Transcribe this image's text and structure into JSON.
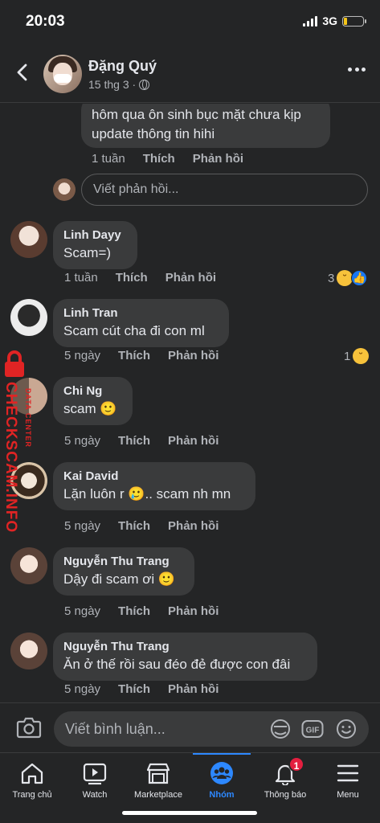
{
  "status": {
    "time": "20:03",
    "network": "3G"
  },
  "header": {
    "name": "Đặng Quý",
    "date": "15 thg 3 ·"
  },
  "top_reply": {
    "text_line1": "hôm qua ôn sinh bục mặt chưa kịp",
    "text_line2": "update thông tin hihi",
    "time": "1 tuần",
    "like": "Thích",
    "reply": "Phản hồi",
    "reply_placeholder": "Viết phản hồi..."
  },
  "comments": [
    {
      "name": "Linh Dayy",
      "text": "Scam=)",
      "time": "1 tuần",
      "like": "Thích",
      "reply": "Phản hồi",
      "reaction_count": "3"
    },
    {
      "name": "Linh Tran",
      "text": "Scam cút cha đi con ml",
      "time": "5 ngày",
      "like": "Thích",
      "reply": "Phản hồi",
      "reaction_count": "1"
    },
    {
      "name": "Chi Ng",
      "text": "scam 🙂",
      "time": "5 ngày",
      "like": "Thích",
      "reply": "Phản hồi"
    },
    {
      "name": "Kai David",
      "text": "Lặn luôn r 🥲.. scam nh mn",
      "time": "5 ngày",
      "like": "Thích",
      "reply": "Phản hồi"
    },
    {
      "name": "Nguyễn Thu Trang",
      "text": "Dậy đi scam ơi 🙂",
      "time": "5 ngày",
      "like": "Thích",
      "reply": "Phản hồi"
    },
    {
      "name": "Nguyễn Thu Trang",
      "text": "Ăn ở thế rồi sau đéo đẻ được con đâi",
      "time": "5 ngày",
      "like": "Thích",
      "reply": "Phản hồi"
    }
  ],
  "watermark": {
    "main": "CHECKSCAM.INFO",
    "sub": "DATA CENTER"
  },
  "composer": {
    "placeholder": "Viết bình luận..."
  },
  "tabs": [
    {
      "label": "Trang chủ",
      "icon": "home-icon"
    },
    {
      "label": "Watch",
      "icon": "watch-icon"
    },
    {
      "label": "Marketplace",
      "icon": "marketplace-icon"
    },
    {
      "label": "Nhóm",
      "icon": "groups-icon",
      "active": true
    },
    {
      "label": "Thông báo",
      "icon": "bell-icon",
      "badge": "1"
    },
    {
      "label": "Menu",
      "icon": "menu-icon"
    }
  ],
  "colors": {
    "accent": "#2d88ff",
    "background": "#242526",
    "bubble": "#3a3b3c",
    "badge": "#e41e3f",
    "watermark": "#e02424"
  }
}
